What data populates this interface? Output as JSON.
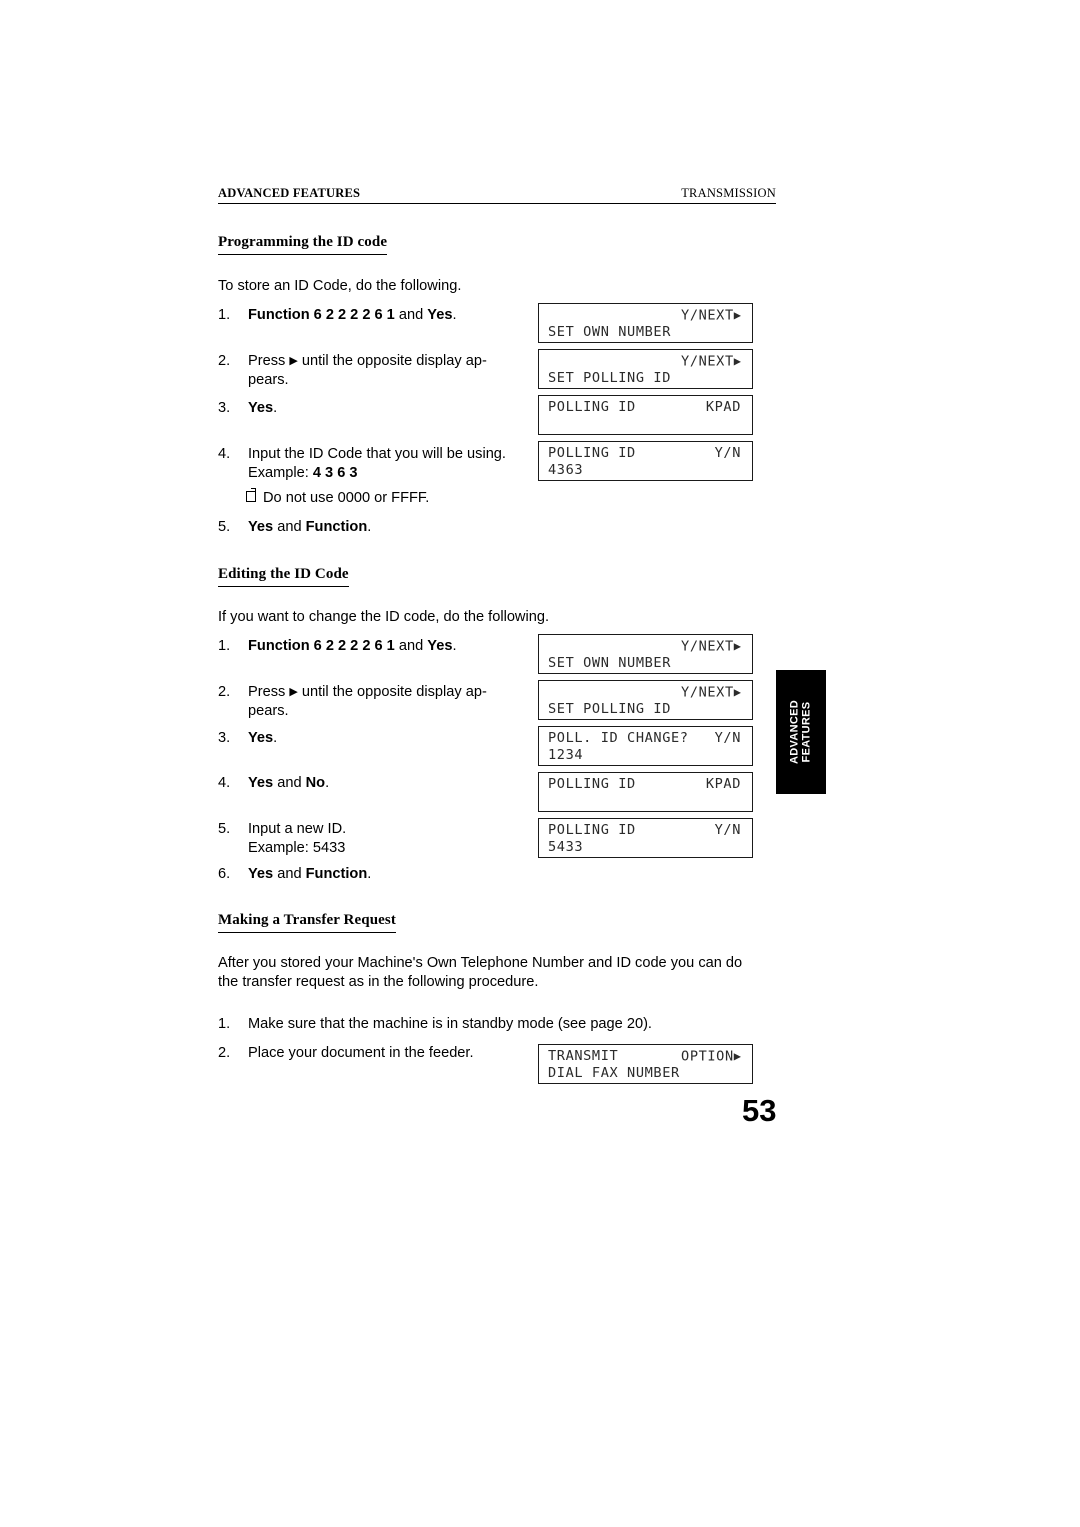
{
  "header": {
    "left": "ADVANCED FEATURES",
    "right": "TRANSMISSION"
  },
  "sections": {
    "programming": {
      "heading": "Programming the ID code",
      "intro": "To store an ID Code, do the following.",
      "steps": [
        {
          "num": "1.",
          "text_parts": [
            {
              "t": "Function 6 2 2 2 2 6 1",
              "bold": true
            },
            {
              "t": " and ",
              "bold": false
            },
            {
              "t": "Yes",
              "bold": true
            },
            {
              "t": ".",
              "bold": false
            }
          ]
        },
        {
          "num": "2.",
          "text_parts": [
            {
              "t": "Press ",
              "bold": false
            },
            {
              "t": "▶",
              "bold": false,
              "arrow": true
            },
            {
              "t": " until the opposite display ap-",
              "bold": false
            },
            {
              "t": "\npears.",
              "bold": false
            }
          ]
        },
        {
          "num": "3.",
          "text_parts": [
            {
              "t": "Yes",
              "bold": true
            },
            {
              "t": ".",
              "bold": false
            }
          ]
        },
        {
          "num": "4.",
          "text_parts": [
            {
              "t": "Input the ID Code that you will be using.",
              "bold": false
            },
            {
              "t": "\nExample: ",
              "bold": false
            },
            {
              "t": "4 3 6 3",
              "bold": true
            }
          ]
        },
        {
          "num": "5.",
          "text_parts": [
            {
              "t": "Yes",
              "bold": true
            },
            {
              "t": " and ",
              "bold": false
            },
            {
              "t": "Function",
              "bold": true
            },
            {
              "t": ".",
              "bold": false
            }
          ]
        }
      ],
      "note": "Do not use 0000 or FFFF.",
      "displays": [
        {
          "line1_right": "Y/NEXT",
          "line1_tri": "▶",
          "line2": "SET OWN NUMBER",
          "layout": "topright"
        },
        {
          "line1_right": "Y/NEXT",
          "line1_tri": "▶",
          "line2": "SET POLLING ID",
          "layout": "topright"
        },
        {
          "line1_left": "POLLING ID",
          "line1_right": "KPAD",
          "line2": "",
          "layout": "split"
        },
        {
          "line1_left": "POLLING ID",
          "line1_right": "Y/N",
          "line2": "4363",
          "layout": "split"
        }
      ]
    },
    "editing": {
      "heading": "Editing the ID Code",
      "intro": "If you want to change the ID code, do the following.",
      "steps": [
        {
          "num": "1.",
          "text_parts": [
            {
              "t": "Function 6 2 2 2 2 6 1",
              "bold": true
            },
            {
              "t": " and ",
              "bold": false
            },
            {
              "t": "Yes",
              "bold": true
            },
            {
              "t": ".",
              "bold": false
            }
          ]
        },
        {
          "num": "2.",
          "text_parts": [
            {
              "t": "Press ",
              "bold": false
            },
            {
              "t": "▶",
              "bold": false,
              "arrow": true
            },
            {
              "t": " until the opposite display ap-",
              "bold": false
            },
            {
              "t": "\npears.",
              "bold": false
            }
          ]
        },
        {
          "num": "3.",
          "text_parts": [
            {
              "t": "Yes",
              "bold": true
            },
            {
              "t": ".",
              "bold": false
            }
          ]
        },
        {
          "num": "4.",
          "text_parts": [
            {
              "t": "Yes",
              "bold": true
            },
            {
              "t": " and ",
              "bold": false
            },
            {
              "t": "No",
              "bold": true
            },
            {
              "t": ".",
              "bold": false
            }
          ]
        },
        {
          "num": "5.",
          "text_parts": [
            {
              "t": "Input a new ID.",
              "bold": false
            },
            {
              "t": "\nExample: 5433",
              "bold": false
            }
          ]
        },
        {
          "num": "6.",
          "text_parts": [
            {
              "t": "Yes",
              "bold": true
            },
            {
              "t": " and ",
              "bold": false
            },
            {
              "t": "Function",
              "bold": true
            },
            {
              "t": ".",
              "bold": false
            }
          ]
        }
      ],
      "displays": [
        {
          "line1_right": "Y/NEXT",
          "line1_tri": "▶",
          "line2": "SET OWN NUMBER",
          "layout": "topright"
        },
        {
          "line1_right": "Y/NEXT",
          "line1_tri": "▶",
          "line2": "SET POLLING ID",
          "layout": "topright"
        },
        {
          "line1_left": "POLL. ID CHANGE?",
          "line1_right": "Y/N",
          "line2": "1234",
          "layout": "split"
        },
        {
          "line1_left": "POLLING ID",
          "line1_right": "KPAD",
          "line2": "",
          "layout": "split"
        },
        {
          "line1_left": "POLLING ID",
          "line1_right": "Y/N",
          "line2": "5433",
          "layout": "split"
        }
      ]
    },
    "transfer": {
      "heading": "Making a Transfer Request",
      "intro_line1": "After you stored your Machine's Own Telephone Number and ID code you can do",
      "intro_line2": "the transfer request as in the following procedure.",
      "steps": [
        {
          "num": "1.",
          "text_parts": [
            {
              "t": "Make sure that the machine is in standby mode (see page 20).",
              "bold": false
            }
          ]
        },
        {
          "num": "2.",
          "text_parts": [
            {
              "t": "Place your document in the feeder.",
              "bold": false
            }
          ]
        }
      ],
      "displays": [
        {
          "line1_left": "TRANSMIT",
          "line1_right": "OPTION",
          "line1_tri": "▶",
          "line2": "DIAL FAX NUMBER",
          "layout": "split"
        }
      ]
    }
  },
  "side_tab": {
    "line1": "ADVANCED",
    "line2": "FEATURES"
  },
  "page_number": "53",
  "colors": {
    "text": "#000000",
    "lcd_text": "#2b2b2b",
    "tab_background": "#000000",
    "tab_text": "#ffffff"
  }
}
